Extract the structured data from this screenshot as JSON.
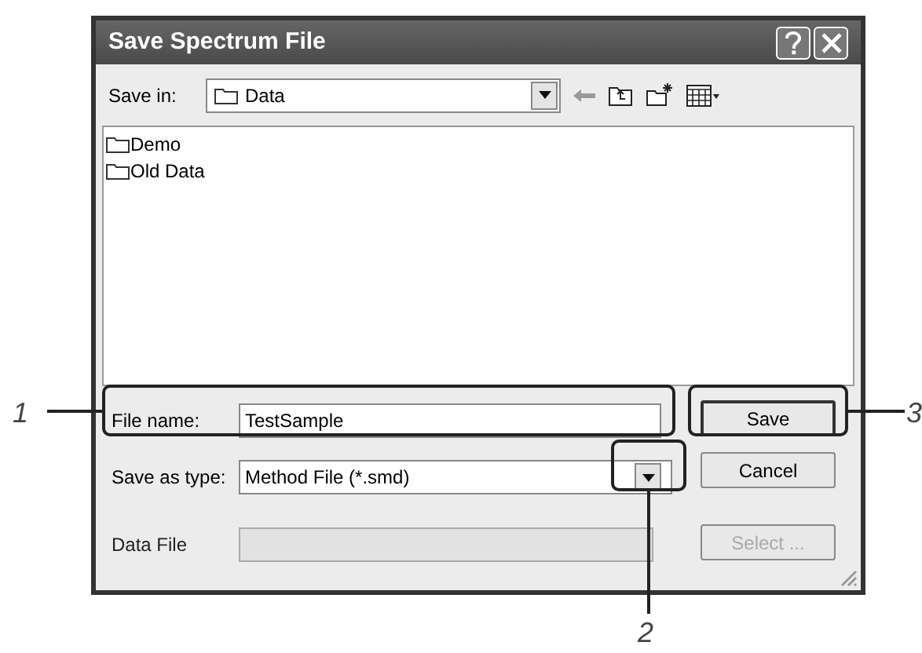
{
  "window": {
    "title": "Save Spectrum File"
  },
  "save_in": {
    "label": "Save in:",
    "value": "Data"
  },
  "files": [
    {
      "name": "Demo",
      "selected": false
    },
    {
      "name": "Old Data",
      "selected": false
    }
  ],
  "fields": [
    {
      "kind": "text",
      "label": "File name:",
      "value": "TestSample",
      "disabled": false
    },
    {
      "kind": "dropdown",
      "label": "Save as type:",
      "value": "Method File (*.smd)",
      "disabled": false
    },
    {
      "kind": "text",
      "label": "Data File",
      "disabled": true
    }
  ],
  "buttons": [
    {
      "label": "Save",
      "disabled": false,
      "default": true
    },
    {
      "label": "Cancel",
      "disabled": false,
      "default": false
    },
    {
      "label": "Select ...",
      "disabled": true,
      "default": false
    }
  ],
  "callouts": [
    {
      "number": "1"
    },
    {
      "number": "2"
    },
    {
      "number": "3"
    }
  ]
}
